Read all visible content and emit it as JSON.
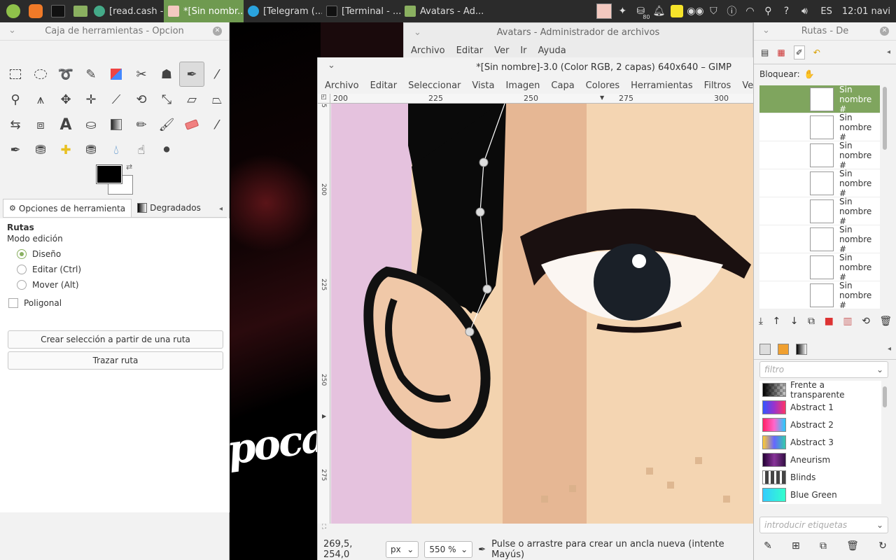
{
  "taskbar": {
    "tasks": [
      {
        "label": "[read.cash - ..."
      },
      {
        "label": "*[Sin nombr..."
      },
      {
        "label": "[Telegram (..."
      },
      {
        "label": "[Terminal - ..."
      },
      {
        "label": "Avatars - Ad..."
      }
    ],
    "keyboard_layout": "ES",
    "clock": "12:01 navi",
    "tray_badge": "80"
  },
  "toolbox": {
    "title": "Caja de herramientas - Opcion",
    "tabs": [
      {
        "label": "Opciones de herramienta"
      },
      {
        "label": "Degradados"
      }
    ],
    "options": {
      "heading": "Rutas",
      "mode_label": "Modo edición",
      "modes": [
        {
          "label": "Diseño",
          "checked": true
        },
        {
          "label": "Editar (Ctrl)",
          "checked": false
        },
        {
          "label": "Mover (Alt)",
          "checked": false
        }
      ],
      "polygonal_label": "Poligonal",
      "btn_selection": "Crear selección a partir de una ruta",
      "btn_stroke": "Trazar ruta"
    }
  },
  "filemanager": {
    "title": "Avatars - Administrador de archivos",
    "menu": [
      "Archivo",
      "Editar",
      "Ver",
      "Ir",
      "Ayuda"
    ]
  },
  "gimp": {
    "title": "*[Sin nombre]-3.0 (Color RGB, 2 capas) 640x640 – GIMP",
    "menu": [
      "Archivo",
      "Editar",
      "Seleccionar",
      "Vista",
      "Imagen",
      "Capa",
      "Colores",
      "Herramientas",
      "Filtros",
      "Ventanas"
    ],
    "ruler_h": [
      "200",
      "225",
      "250",
      "275",
      "300"
    ],
    "ruler_v": [
      "5",
      "200",
      "225",
      "250",
      "275"
    ],
    "status": {
      "coords": "269,5, 254,0",
      "unit": "px",
      "zoom": "550 %",
      "message": "Pulse o arrastre para crear un ancla nueva (intente Mayús)"
    }
  },
  "paths": {
    "title": "Rutas - De",
    "lock_label": "Bloquear:",
    "items": [
      {
        "label": "Sin nombre #"
      },
      {
        "label": "Sin nombre #"
      },
      {
        "label": "Sin nombre #"
      },
      {
        "label": "Sin nombre #"
      },
      {
        "label": "Sin nombre #"
      },
      {
        "label": "Sin nombre #"
      },
      {
        "label": "Sin nombre #"
      },
      {
        "label": "Sin nombre #"
      }
    ]
  },
  "gradients": {
    "filter_placeholder": "filtro",
    "tag_placeholder": "introducir etiquetas",
    "items": [
      {
        "label": "Frente a transparente",
        "swatch": "linear-gradient(90deg,#000,rgba(0,0,0,0)),repeating-conic-gradient(#999 0 25%,#ccc 0 50%) 0 0/8px 8px"
      },
      {
        "label": "Abstract 1",
        "swatch": "linear-gradient(90deg,#3355ff,#9933cc,#ff3366)"
      },
      {
        "label": "Abstract 2",
        "swatch": "linear-gradient(90deg,#ff2266,#ff66cc,#22ccff)"
      },
      {
        "label": "Abstract 3",
        "swatch": "linear-gradient(90deg,#ffcc33,#6666ff,#33ccaa)"
      },
      {
        "label": "Aneurism",
        "swatch": "linear-gradient(90deg,#220033,#883399,#331144)"
      },
      {
        "label": "Blinds",
        "swatch": "repeating-linear-gradient(90deg,#fff 0 3px,#444 3px 8px)"
      },
      {
        "label": "Blue Green",
        "swatch": "linear-gradient(90deg,#33ccff,#33ffcc)"
      }
    ]
  }
}
